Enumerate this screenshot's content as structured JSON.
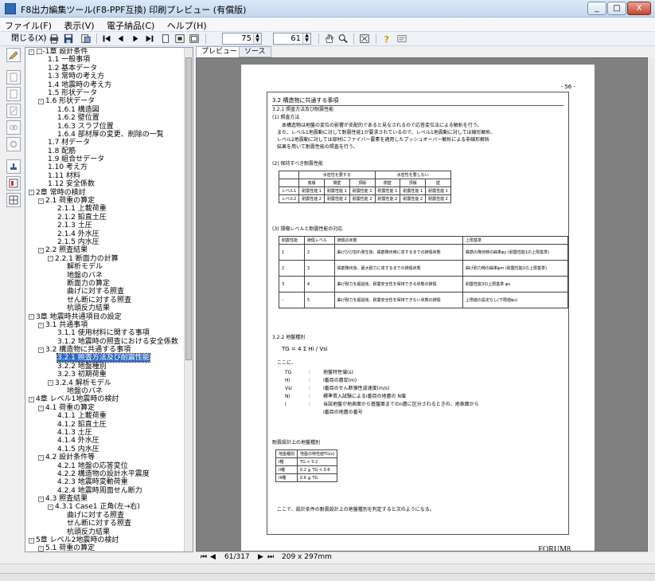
{
  "window": {
    "title": "F8出力編集ツール(F8-PPF互換) 印刷プレビュー (有償版)",
    "btn_min": "_",
    "btn_max": "□",
    "btn_close": "X"
  },
  "menu": [
    "ファイル(F)",
    "表示(V)",
    "電子納品(C)",
    "ヘルプ(H)"
  ],
  "toolbar": {
    "close_label": "閉じる(X)",
    "zoom_value": "75",
    "page_value": "61"
  },
  "tabs": [
    "プレビュー",
    "ソース"
  ],
  "tree": [
    {
      "t": "□-1章 設計条件",
      "lv": 0,
      "box": "-"
    },
    {
      "t": "1.1 一般事項",
      "lv": 2
    },
    {
      "t": "1.2 基本データ",
      "lv": 2
    },
    {
      "t": "1.3 常時の考え方",
      "lv": 2
    },
    {
      "t": "1.4 地震時の考え方",
      "lv": 2
    },
    {
      "t": "1.5 形状データ",
      "lv": 2
    },
    {
      "t": "1.6 形状データ",
      "lv": 1,
      "box": "-"
    },
    {
      "t": "1.6.1 構造図",
      "lv": 3
    },
    {
      "t": "1.6.2 壁位置",
      "lv": 3
    },
    {
      "t": "1.6.3 スラブ位置",
      "lv": 3
    },
    {
      "t": "1.6.4 部材厚の変更、削除の一覧",
      "lv": 3
    },
    {
      "t": "1.7 材データ",
      "lv": 2
    },
    {
      "t": "1.8 配筋",
      "lv": 2
    },
    {
      "t": "1.9 組合せデータ",
      "lv": 2
    },
    {
      "t": "1.10 考え方",
      "lv": 2
    },
    {
      "t": "1.11 材料",
      "lv": 2
    },
    {
      "t": "1.12 安全係数",
      "lv": 2
    },
    {
      "t": "2章 常時の検討",
      "lv": 0,
      "box": "-"
    },
    {
      "t": "2.1 荷重の算定",
      "lv": 1,
      "box": "-"
    },
    {
      "t": "2.1.1 上載荷重",
      "lv": 3
    },
    {
      "t": "2.1.2 鉛直土圧",
      "lv": 3
    },
    {
      "t": "2.1.3 土圧",
      "lv": 3
    },
    {
      "t": "2.1.4 外水圧",
      "lv": 3
    },
    {
      "t": "2.1.5 内水圧",
      "lv": 3
    },
    {
      "t": "2.2 照査結果",
      "lv": 1,
      "box": "-"
    },
    {
      "t": "2.2.1 断面力の計算",
      "lv": 2,
      "box": "-"
    },
    {
      "t": "解析モデル",
      "lv": 4
    },
    {
      "t": "地盤のバネ",
      "lv": 4
    },
    {
      "t": "断面力の算定",
      "lv": 4
    },
    {
      "t": "曲げに対する照査",
      "lv": 4
    },
    {
      "t": "せん断に対する照査",
      "lv": 4
    },
    {
      "t": "杭頭反力結果",
      "lv": 4
    },
    {
      "t": "3章 地震時共通項目の設定",
      "lv": 0,
      "box": "-"
    },
    {
      "t": "3.1 共通事項",
      "lv": 1,
      "box": "-"
    },
    {
      "t": "3.1.1 使用材料に関する事項",
      "lv": 3
    },
    {
      "t": "3.1.2 地震時の照査における安全係数",
      "lv": 3
    },
    {
      "t": "3.2 構造物に共通する事項",
      "lv": 1,
      "box": "-"
    },
    {
      "t": "3.2.1 照査方法及び耐震性能",
      "lv": 3,
      "sel": true
    },
    {
      "t": "3.2.2 地盤種別",
      "lv": 3
    },
    {
      "t": "3.2.3 初期荷重",
      "lv": 3
    },
    {
      "t": "3.2.4 解析モデル",
      "lv": 2,
      "box": "-"
    },
    {
      "t": "地盤のバネ",
      "lv": 4
    },
    {
      "t": "4章 レベル1地震時の検討",
      "lv": 0,
      "box": "-"
    },
    {
      "t": "4.1 荷重の算定",
      "lv": 1,
      "box": "-"
    },
    {
      "t": "4.1.1 上載荷重",
      "lv": 3
    },
    {
      "t": "4.1.2 鉛直土圧",
      "lv": 3
    },
    {
      "t": "4.1.3 土圧",
      "lv": 3
    },
    {
      "t": "4.1.4 外水圧",
      "lv": 3
    },
    {
      "t": "4.1.5 内水圧",
      "lv": 3
    },
    {
      "t": "4.2 設計条件等",
      "lv": 1,
      "box": "-"
    },
    {
      "t": "4.2.1 地盤の応答変位",
      "lv": 3
    },
    {
      "t": "4.2.2 構造物の設計水平震度",
      "lv": 3
    },
    {
      "t": "4.2.3 地震時変動荷重",
      "lv": 3
    },
    {
      "t": "4.2.4 地震時周面せん断力",
      "lv": 3
    },
    {
      "t": "4.3 照査結果",
      "lv": 1,
      "box": "-"
    },
    {
      "t": "4.3.1 Case1 正角(左→右)",
      "lv": 2,
      "box": "-"
    },
    {
      "t": "曲げに対する照査",
      "lv": 4
    },
    {
      "t": "せん断に対する照査",
      "lv": 4
    },
    {
      "t": "杭頭反力結果",
      "lv": 4
    },
    {
      "t": "5章 レベル2地震時の検討",
      "lv": 0,
      "box": "-"
    },
    {
      "t": "5.1 荷重の算定",
      "lv": 1,
      "box": "-"
    }
  ],
  "doc": {
    "page_no": "- 56 -",
    "heading": "3.2 構造物に共通する事項",
    "sub1": "3.2.1 照査方法及び耐震性能",
    "p1_title": "(1) 照査方法",
    "p1_l1": "本構造物は地盤の変位の影響が支配的であると見なされるので応答変位法による解析を行う。",
    "p1_l2": "また、レベル1地震動に対して耐震性能1が要求されているので、レベル1地震動に対しては線形解析、",
    "p1_l3": "レベル2地震動に対しては部材にファイバー要素を適用したプッシュオーバー解析による非線形解析",
    "p1_l4": "結果を用いて耐震性能の照査を行う。",
    "p2_title": "(2) 保持すべき耐震性能",
    "t1_head": [
      "",
      "水密性を要する",
      "",
      "",
      "水密性を要しない",
      "",
      ""
    ],
    "t1_sub": [
      "",
      "底版",
      "側壁",
      "頂版",
      "側壁",
      "頂版",
      "壁"
    ],
    "t1_rows": [
      [
        "レベル1",
        "耐震性能 1",
        "耐震性能 1",
        "耐震性能 1",
        "耐震性能 1",
        "耐震性能 1",
        "耐震性能 1"
      ],
      [
        "レベル2",
        "耐震性能 2",
        "耐震性能 2",
        "耐震性能 2",
        "耐震性能 2",
        "耐震性能 2",
        "耐震性能 2"
      ]
    ],
    "p3_title": "(3) 損傷レベルと耐震性能の対応",
    "t2_head": [
      "耐震性能",
      "損傷レベル",
      "損傷の状態",
      "上限基準"
    ],
    "t2_rows": [
      [
        "1",
        "2",
        "曲げひび割れ発生後、鉄筋降伏時に達するまでの損傷状態",
        "鉄筋の降伏時の曲率φy (耐震性能1の上限基準)"
      ],
      [
        "2",
        "3",
        "鉄筋降伏後、最大耐力に達するまでの損傷状態",
        "曲げ耐力時の曲率φm (耐震性能2の上限基準)"
      ],
      [
        "3",
        "4",
        "曲げ耐力を超過後、耐震安全性を保持できる状態の損傷",
        "耐震性能3の上限基準 φu"
      ],
      [
        "-",
        "5",
        "曲げ耐力を超過後、耐震安全性を保持できない状態の損傷",
        "上限値の設定なし(下限値φu)"
      ]
    ],
    "sub2": "3.2.2 地盤種別",
    "formula": "TG = 4 Σ Hi / Vsi",
    "koko": "ここに、",
    "defs": [
      [
        "TG",
        ":",
        "地盤特性値(s)"
      ],
      [
        "Hi",
        ":",
        "i番目の層厚(m)"
      ],
      [
        "Vsi",
        ":",
        "i番目のせん断弾性波速度(m/s)"
      ],
      [
        "Ni",
        ":",
        "標準貫入試験によるi番目の地層の N値"
      ],
      [
        "i",
        ":",
        "当該地盤が地表面から基盤面までのn層に区分されるときの、地表面から"
      ],
      [
        "",
        "",
        "i番目の地層の番号"
      ]
    ],
    "t3_title": "耐震設計上の地盤種別",
    "t3_head": [
      "地盤種別",
      "地盤の特性値TG(s)"
    ],
    "t3_rows": [
      [
        "I種",
        "TG < 0.2"
      ],
      [
        "II種",
        "0.2 ≦ TG < 0.6"
      ],
      [
        "III種",
        "0.6 ≦ TG"
      ]
    ],
    "conclusion": "ここで、設計条件の耐震設計上の地盤種別を判定すると次のようになる。",
    "brand": "FORUM8"
  },
  "nav": {
    "page": "61/317",
    "size": "209 x 297mm"
  }
}
